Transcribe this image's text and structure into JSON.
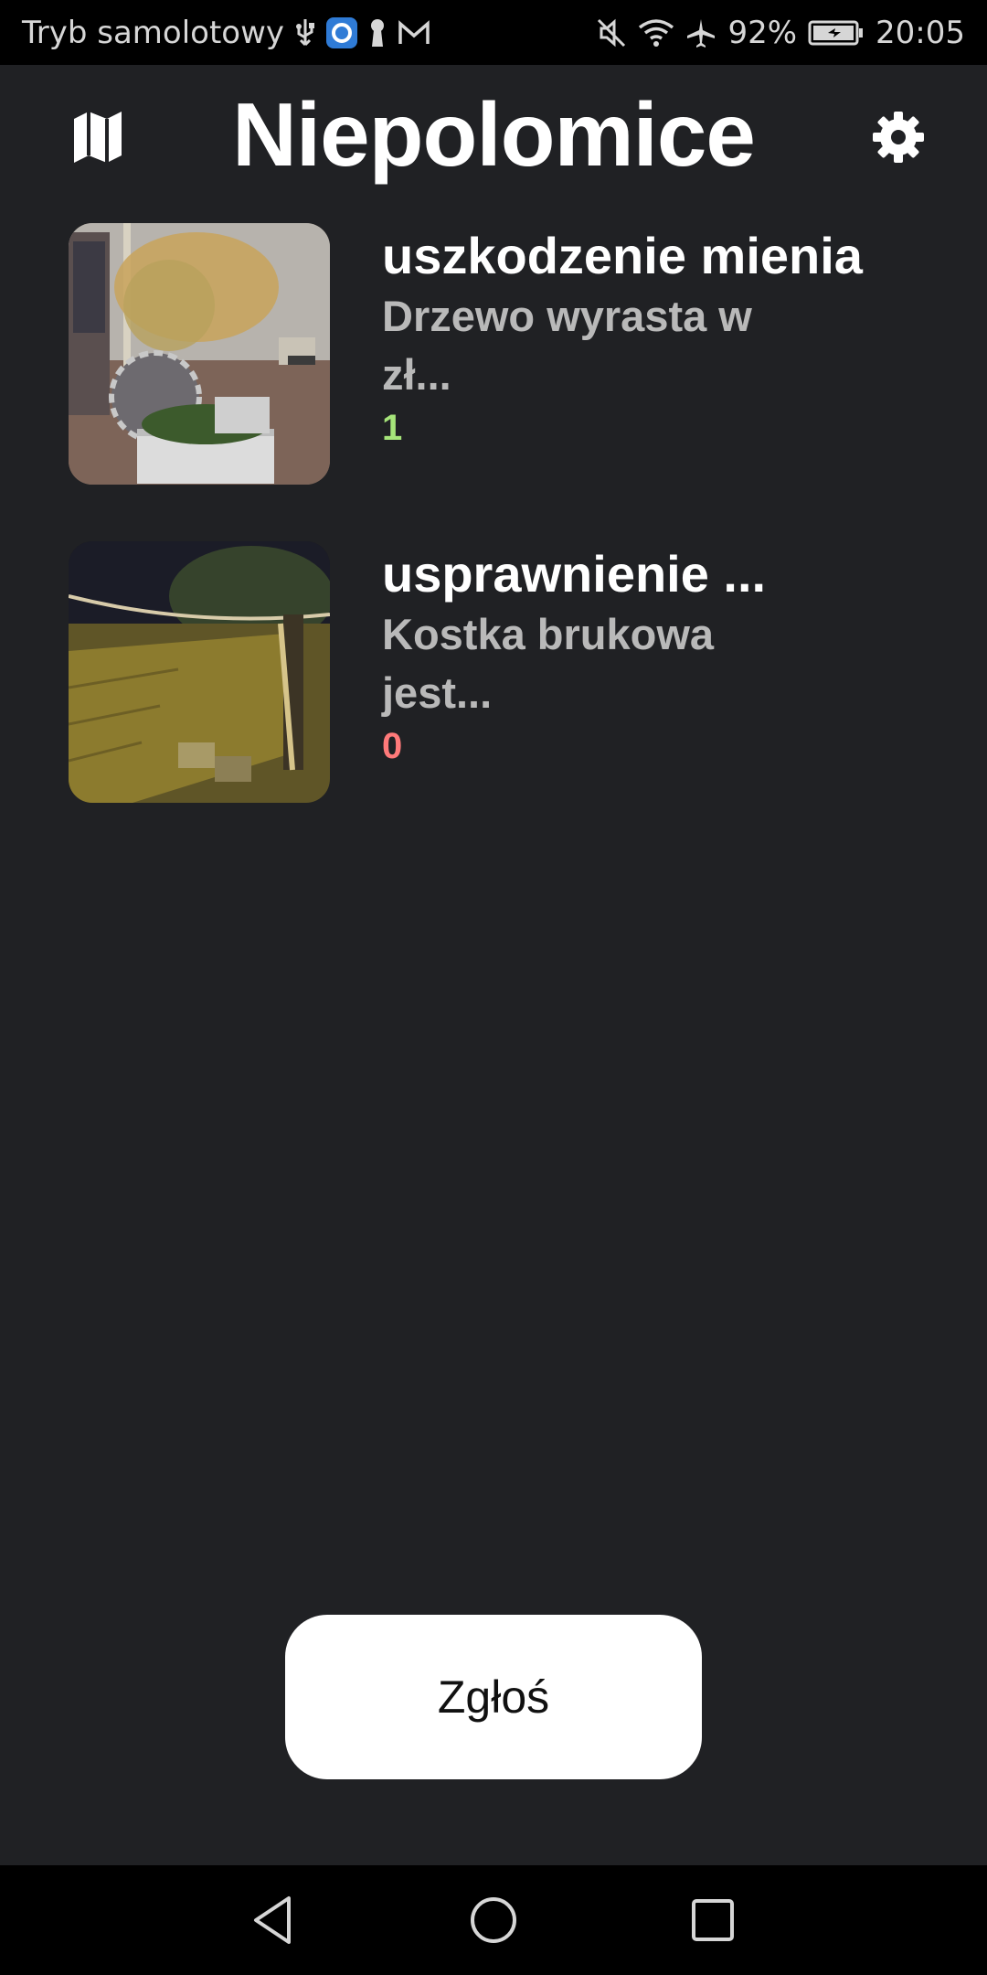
{
  "status_bar": {
    "carrier_text": "Tryb samolotowy",
    "battery_percent": "92%",
    "time": "20:05",
    "icons_left": [
      "usb-icon",
      "app-notification-icon",
      "keyhole-icon",
      "gmail-icon"
    ],
    "icons_right": [
      "mute-icon",
      "wifi-icon",
      "airplane-icon",
      "battery-icon"
    ]
  },
  "header": {
    "title": "Niepolomice",
    "left_icon": "map-icon",
    "right_icon": "gear-icon"
  },
  "reports": [
    {
      "title": "uszkodzenie mienia",
      "description": "Drzewo wyrasta w zł...",
      "count": "1",
      "count_color": "#a6e57a"
    },
    {
      "title": "usprawnienie ...",
      "description": "Kostka brukowa jest...",
      "count": "0",
      "count_color": "#ff7a7a"
    }
  ],
  "report_button": {
    "label": "Zgłoś"
  },
  "colors": {
    "background": "#202124",
    "status_bar": "#000000",
    "button_bg": "#ffffff"
  }
}
